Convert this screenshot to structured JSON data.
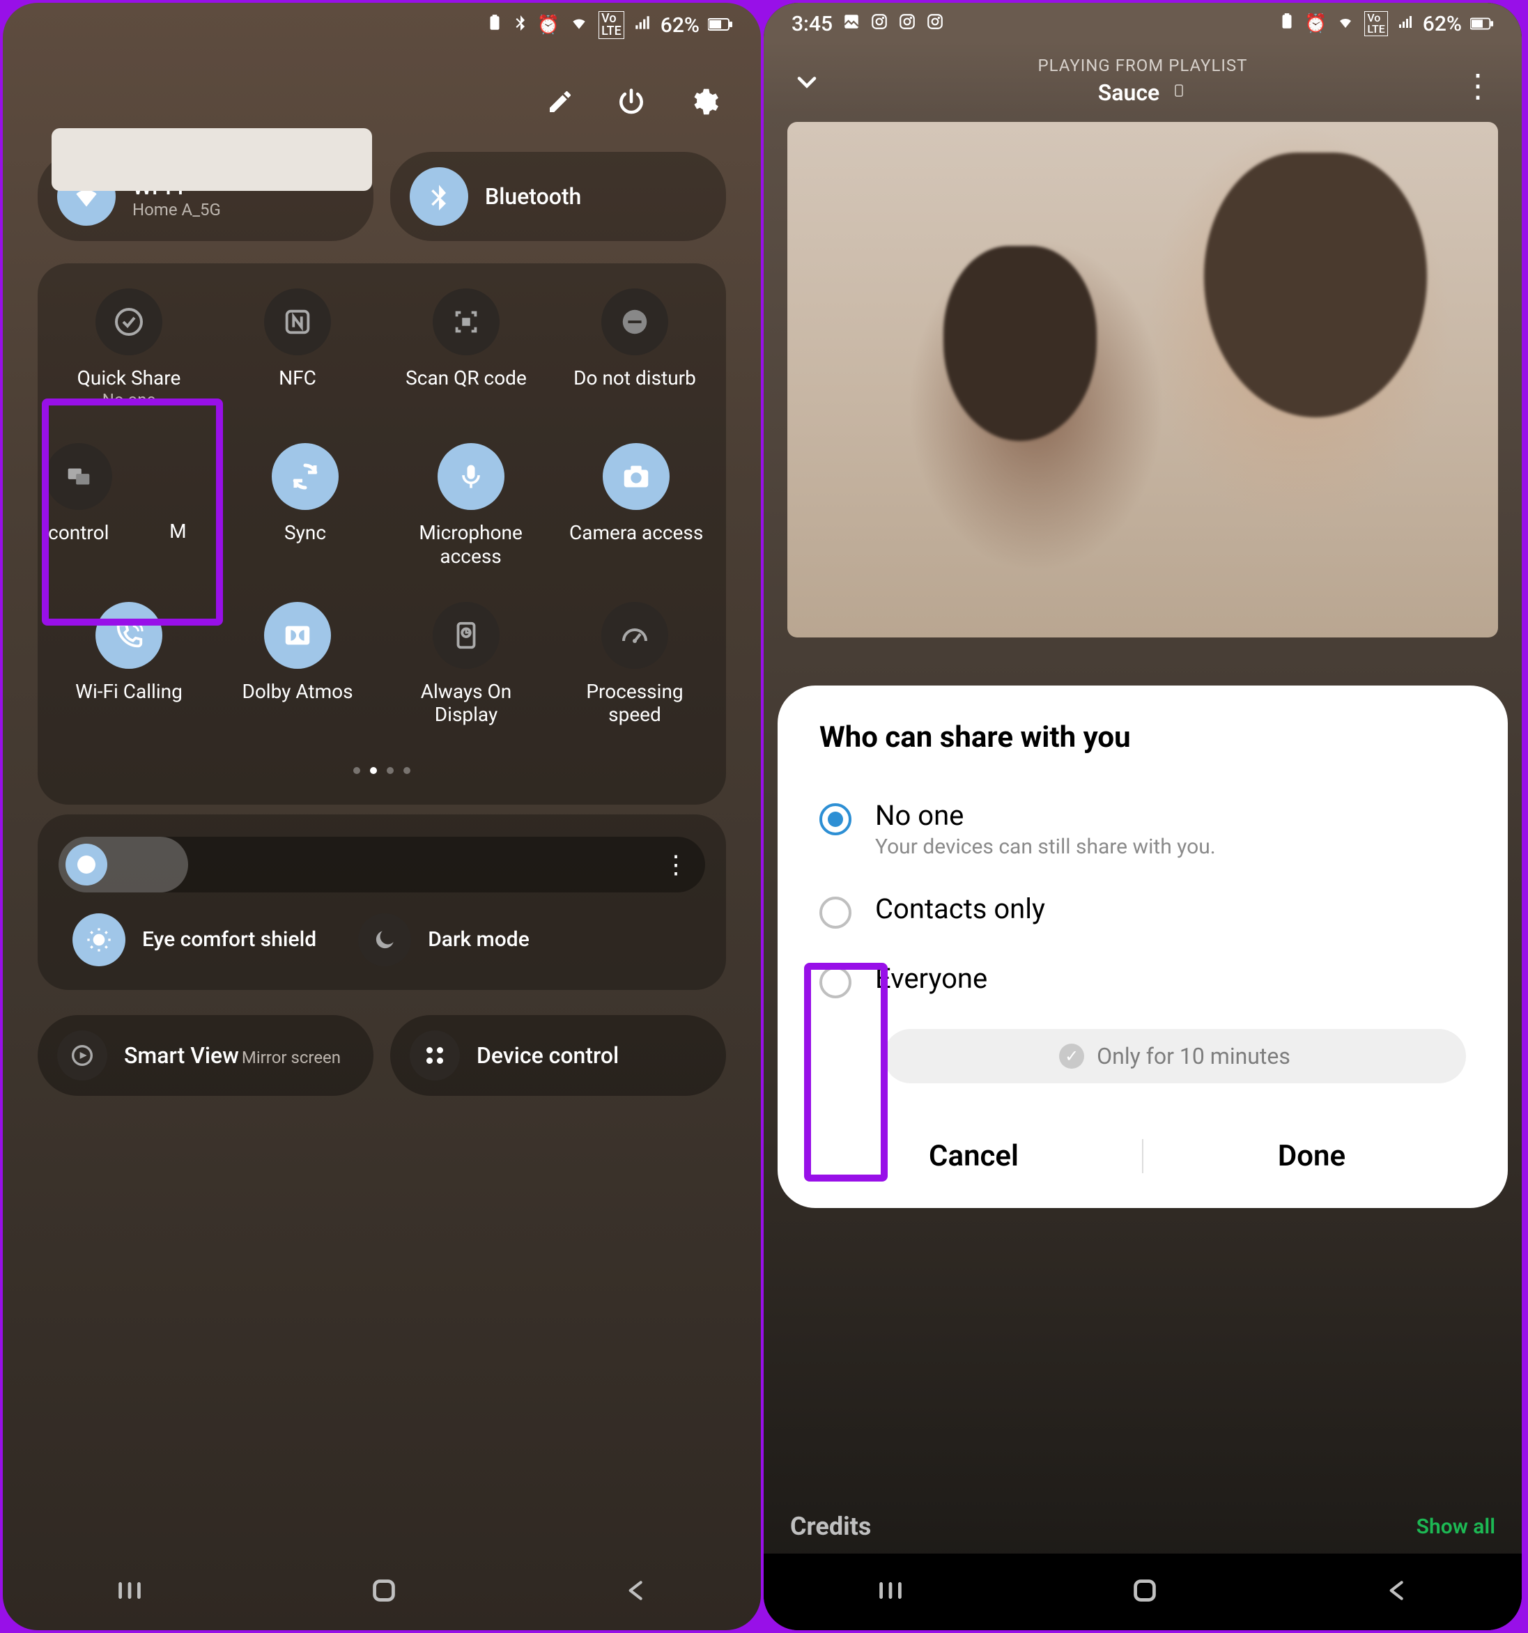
{
  "status": {
    "time": "3:45",
    "battery": "62%"
  },
  "leftPhone": {
    "wifi": {
      "label": "Wi-Fi",
      "sub": "Home A_5G"
    },
    "bluetooth": {
      "label": "Bluetooth"
    },
    "tiles": {
      "quickshare": {
        "label": "Quick Share",
        "sub": "No one"
      },
      "nfc": {
        "label": "NFC"
      },
      "scanqr": {
        "label": "Scan QR code"
      },
      "dnd": {
        "label": "Do not disturb"
      },
      "control": {
        "label": "control"
      },
      "m_item": {
        "label": "M"
      },
      "sync": {
        "label": "Sync"
      },
      "mic": {
        "label": "Microphone access"
      },
      "camera": {
        "label": "Camera access"
      },
      "wificalling": {
        "label": "Wi-Fi Calling"
      },
      "dolby": {
        "label": "Dolby Atmos"
      },
      "aod": {
        "label": "Always On Display"
      },
      "procspeed": {
        "label": "Processing speed"
      }
    },
    "eyeComfort": "Eye comfort shield",
    "darkMode": "Dark mode",
    "smartView": {
      "label": "Smart View",
      "sub": "Mirror screen"
    },
    "deviceControl": {
      "label": "Device control"
    }
  },
  "rightPhone": {
    "playingFrom": "PLAYING FROM PLAYLIST",
    "playlist": "Sauce",
    "sheet": {
      "title": "Who can share with you",
      "options": {
        "noone": {
          "label": "No one",
          "sub": "Your devices can still share with you."
        },
        "contacts": {
          "label": "Contacts only"
        },
        "everyone": {
          "label": "Everyone"
        }
      },
      "chip": "Only for 10 minutes",
      "cancel": "Cancel",
      "done": "Done"
    },
    "credits": "Credits",
    "showAll": "Show all"
  }
}
